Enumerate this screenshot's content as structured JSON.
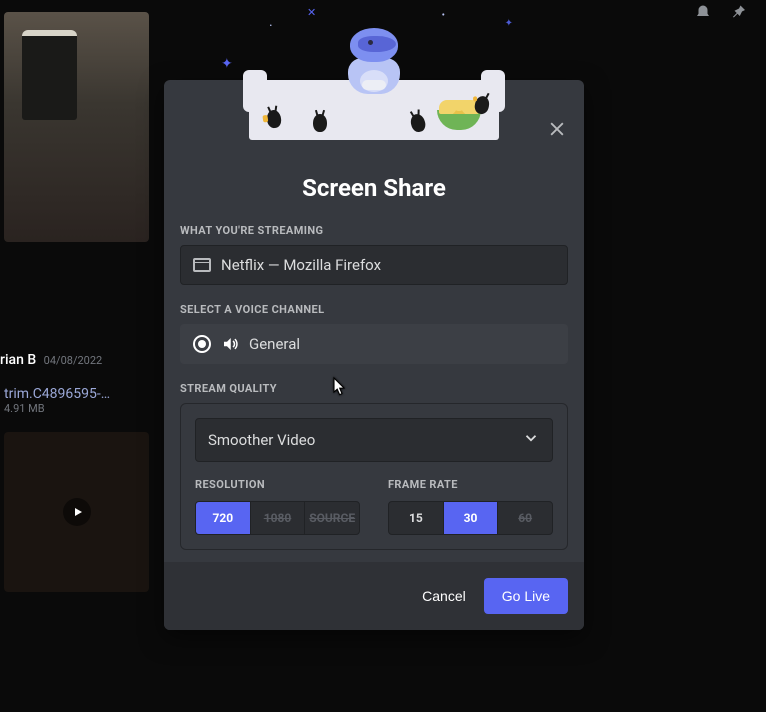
{
  "background": {
    "user_name": "rian B",
    "user_date": "04/08/2022",
    "attachment_name": "trim.C4896595-…",
    "attachment_size": "4.91 MB"
  },
  "modal": {
    "title": "Screen Share",
    "close_icon": "close",
    "streaming": {
      "label": "WHAT YOU'RE STREAMING",
      "value": "Netflix — Mozilla Firefox"
    },
    "voice": {
      "label": "SELECT A VOICE CHANNEL",
      "value": "General"
    },
    "quality": {
      "label": "STREAM QUALITY",
      "preset": "Smoother Video",
      "resolution_label": "RESOLUTION",
      "framerate_label": "FRAME RATE",
      "resolution_options": [
        {
          "label": "720",
          "active": true,
          "locked": false
        },
        {
          "label": "1080",
          "active": false,
          "locked": true
        },
        {
          "label": "SOURCE",
          "active": false,
          "locked": true
        }
      ],
      "framerate_options": [
        {
          "label": "15",
          "active": false,
          "locked": false
        },
        {
          "label": "30",
          "active": true,
          "locked": false
        },
        {
          "label": "60",
          "active": false,
          "locked": true
        }
      ]
    },
    "footer": {
      "cancel": "Cancel",
      "go_live": "Go Live"
    }
  }
}
